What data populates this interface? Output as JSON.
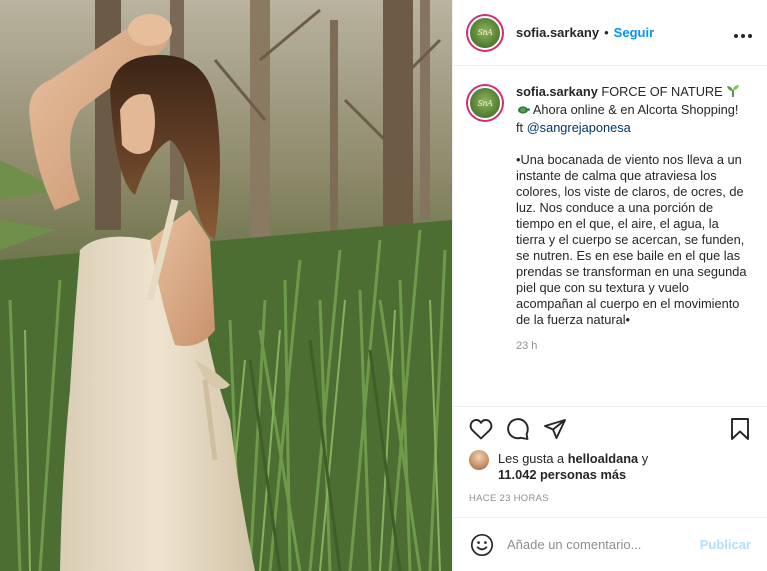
{
  "image": {
    "description_icon": "photo"
  },
  "header": {
    "avatar_icon": "brand-logo-icon",
    "avatar_text": "SnA",
    "username": "sofia.sarkany",
    "separator": "•",
    "follow_label": "Seguir",
    "more_icon": "more-options-icon",
    "more_label": "•••"
  },
  "caption": {
    "username": "sofia.sarkany",
    "title": "FORCE OF NATURE",
    "line2": "Ahora online & en Alcorta Shopping!",
    "ft_prefix": "ft",
    "mention": "@sangrejaponesa",
    "body": "•Una bocanada de viento nos lleva a un instante de calma que atraviesa los colores, los viste de claros, de ocres, de luz. Nos conduce a una porción de tiempo en el que, el aire, el agua, la tierra y el cuerpo se acercan, se funden, se nutren. Es en ese baile en el que las prendas se transforman en una segunda piel que con su textura y vuelo acompañan al cuerpo en el movimiento de la fuerza natural•",
    "time": "23 h"
  },
  "likes": {
    "prefix": "Les gusta a",
    "user": "helloaldana",
    "connector": "y",
    "count": "11.042 personas más"
  },
  "timestamp": "HACE 23 HORAS",
  "comment": {
    "placeholder": "Añade un comentario...",
    "publish_label": "Publicar"
  },
  "colors": {
    "link": "#0095f6",
    "publish_disabled": "#b2dffc",
    "mention": "#00376b",
    "meta": "#8e8e8e"
  }
}
